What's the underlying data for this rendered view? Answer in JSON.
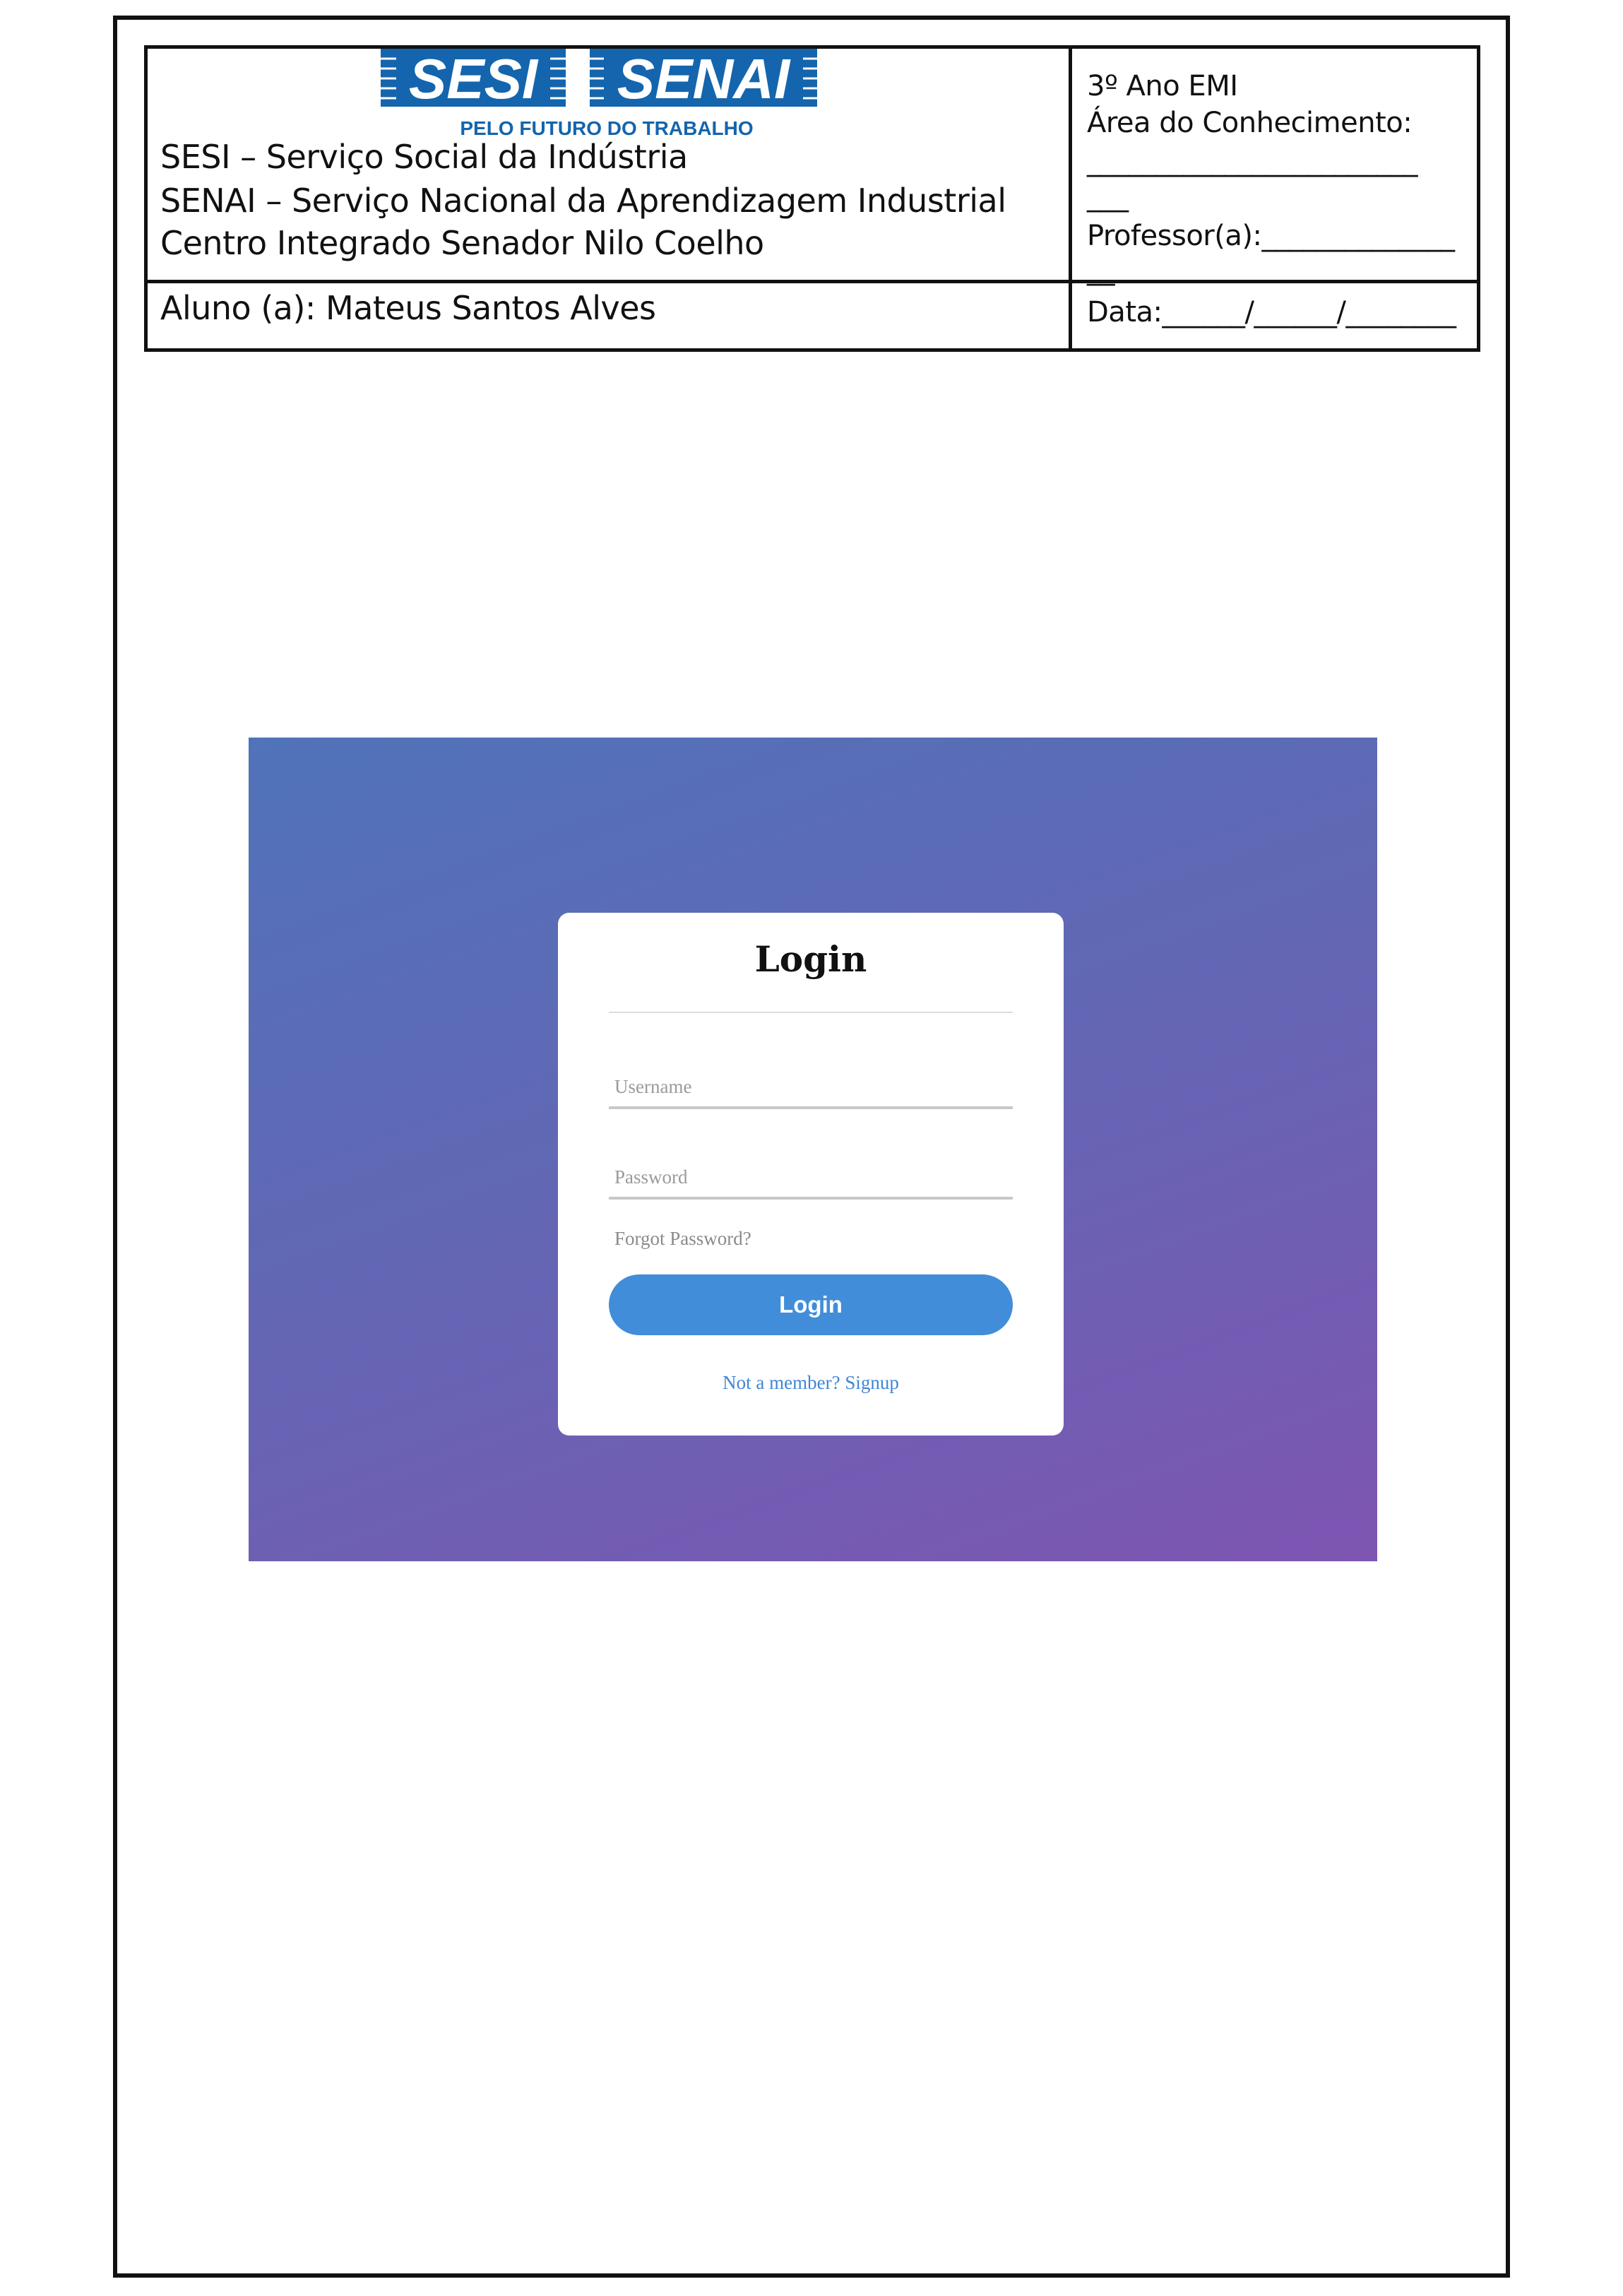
{
  "header": {
    "logo": {
      "left_word": "SESI",
      "right_word": "SENAI",
      "tagline": "PELO FUTURO DO TRABALHO",
      "brand_color": "#1465ad"
    },
    "school_lines": [
      "SESI – Serviço Social da Indústria",
      "SENAI – Serviço Nacional da Aprendizagem Industrial",
      "Centro Integrado Senador Nilo Coelho"
    ],
    "right_lines": [
      "3º Ano EMI",
      "Área do Conhecimento:",
      "________________________",
      "___",
      "Professor(a):______________",
      "__",
      "Data:______/______/________"
    ],
    "student": "Aluno (a): Mateus Santos Alves"
  },
  "login": {
    "title": "Login",
    "username_placeholder": "Username",
    "password_placeholder": "Password",
    "forgot_label": "Forgot Password?",
    "button_label": "Login",
    "signup_label": "Not a member? Signup",
    "colors": {
      "gradient_start": "#5073b9",
      "gradient_end": "#7e55b2",
      "button": "#418dd9",
      "link": "#3f86d6"
    }
  }
}
